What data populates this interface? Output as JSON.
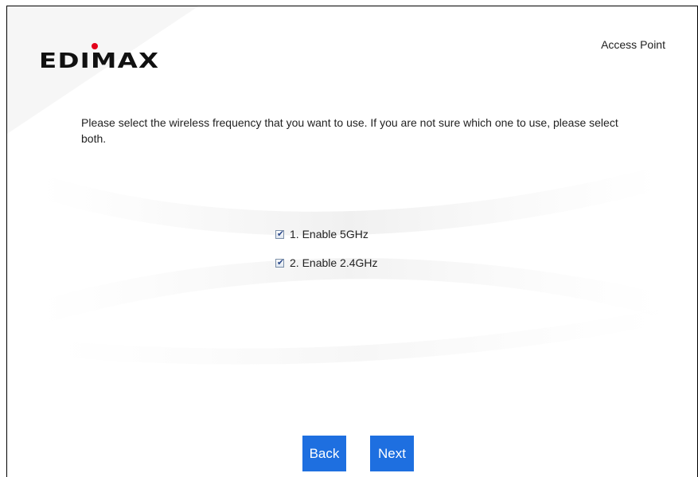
{
  "header": {
    "brand": "EDIMAX",
    "mode_label": "Access Point"
  },
  "main": {
    "instructions": "Please select the wireless frequency that you want to use. If you are not sure which one to use, please select both.",
    "options": [
      {
        "label": "1. Enable 5GHz",
        "checked": true
      },
      {
        "label": "2. Enable 2.4GHz",
        "checked": true
      }
    ],
    "check_glyph": "✔"
  },
  "footer": {
    "back_label": "Back",
    "next_label": "Next"
  },
  "colors": {
    "button_bg": "#1e6fe0",
    "button_text": "#ffffff",
    "logo_dot": "#e3001b"
  }
}
